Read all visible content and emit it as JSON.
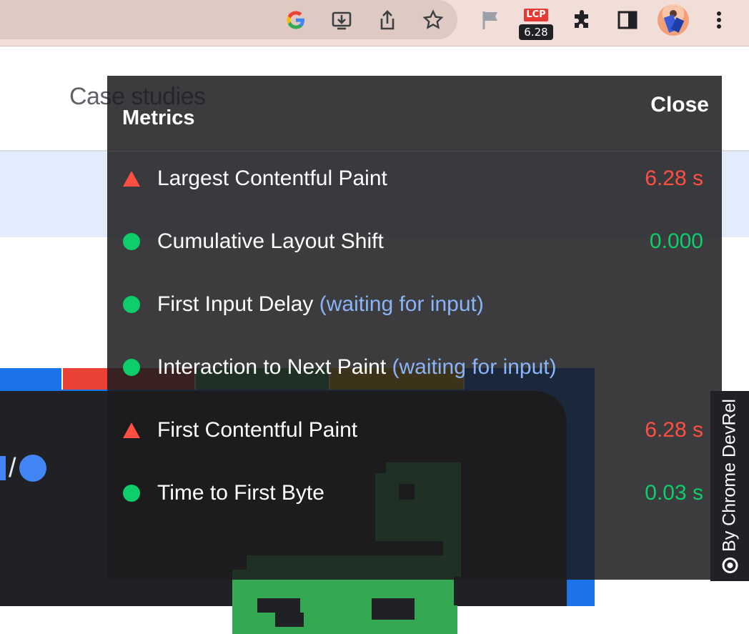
{
  "browser": {
    "lcp_badge": {
      "label": "LCP",
      "value": "6.28"
    },
    "icons": [
      "google-icon",
      "install-icon",
      "share-icon",
      "bookmark-star-icon",
      "flag-icon",
      "extensions-puzzle-icon",
      "side-panel-icon",
      "kebab-menu-icon"
    ]
  },
  "page": {
    "nav_text": "Case studies"
  },
  "overlay": {
    "title": "Metrics",
    "close_label": "Close",
    "metrics": [
      {
        "label": "Largest Contentful Paint",
        "hint": "",
        "value": "6.28 s",
        "status": "poor"
      },
      {
        "label": "Cumulative Layout Shift",
        "hint": "",
        "value": "0.000",
        "status": "good"
      },
      {
        "label": "First Input Delay",
        "hint": "(waiting for input)",
        "value": "",
        "status": "good"
      },
      {
        "label": "Interaction to Next Paint",
        "hint": "(waiting for input)",
        "value": "",
        "status": "good"
      },
      {
        "label": "First Contentful Paint",
        "hint": "",
        "value": "6.28 s",
        "status": "poor"
      },
      {
        "label": "Time to First Byte",
        "hint": "",
        "value": "0.03 s",
        "status": "good"
      }
    ]
  },
  "side_tab": {
    "label": "By Chrome DevRel"
  },
  "colors": {
    "poor": "#ff4e42",
    "good": "#0cce6b",
    "hint": "#8ab4f8",
    "overlay_bg": "#1c1c1e",
    "toolbar_bg": "#f2ded8"
  }
}
